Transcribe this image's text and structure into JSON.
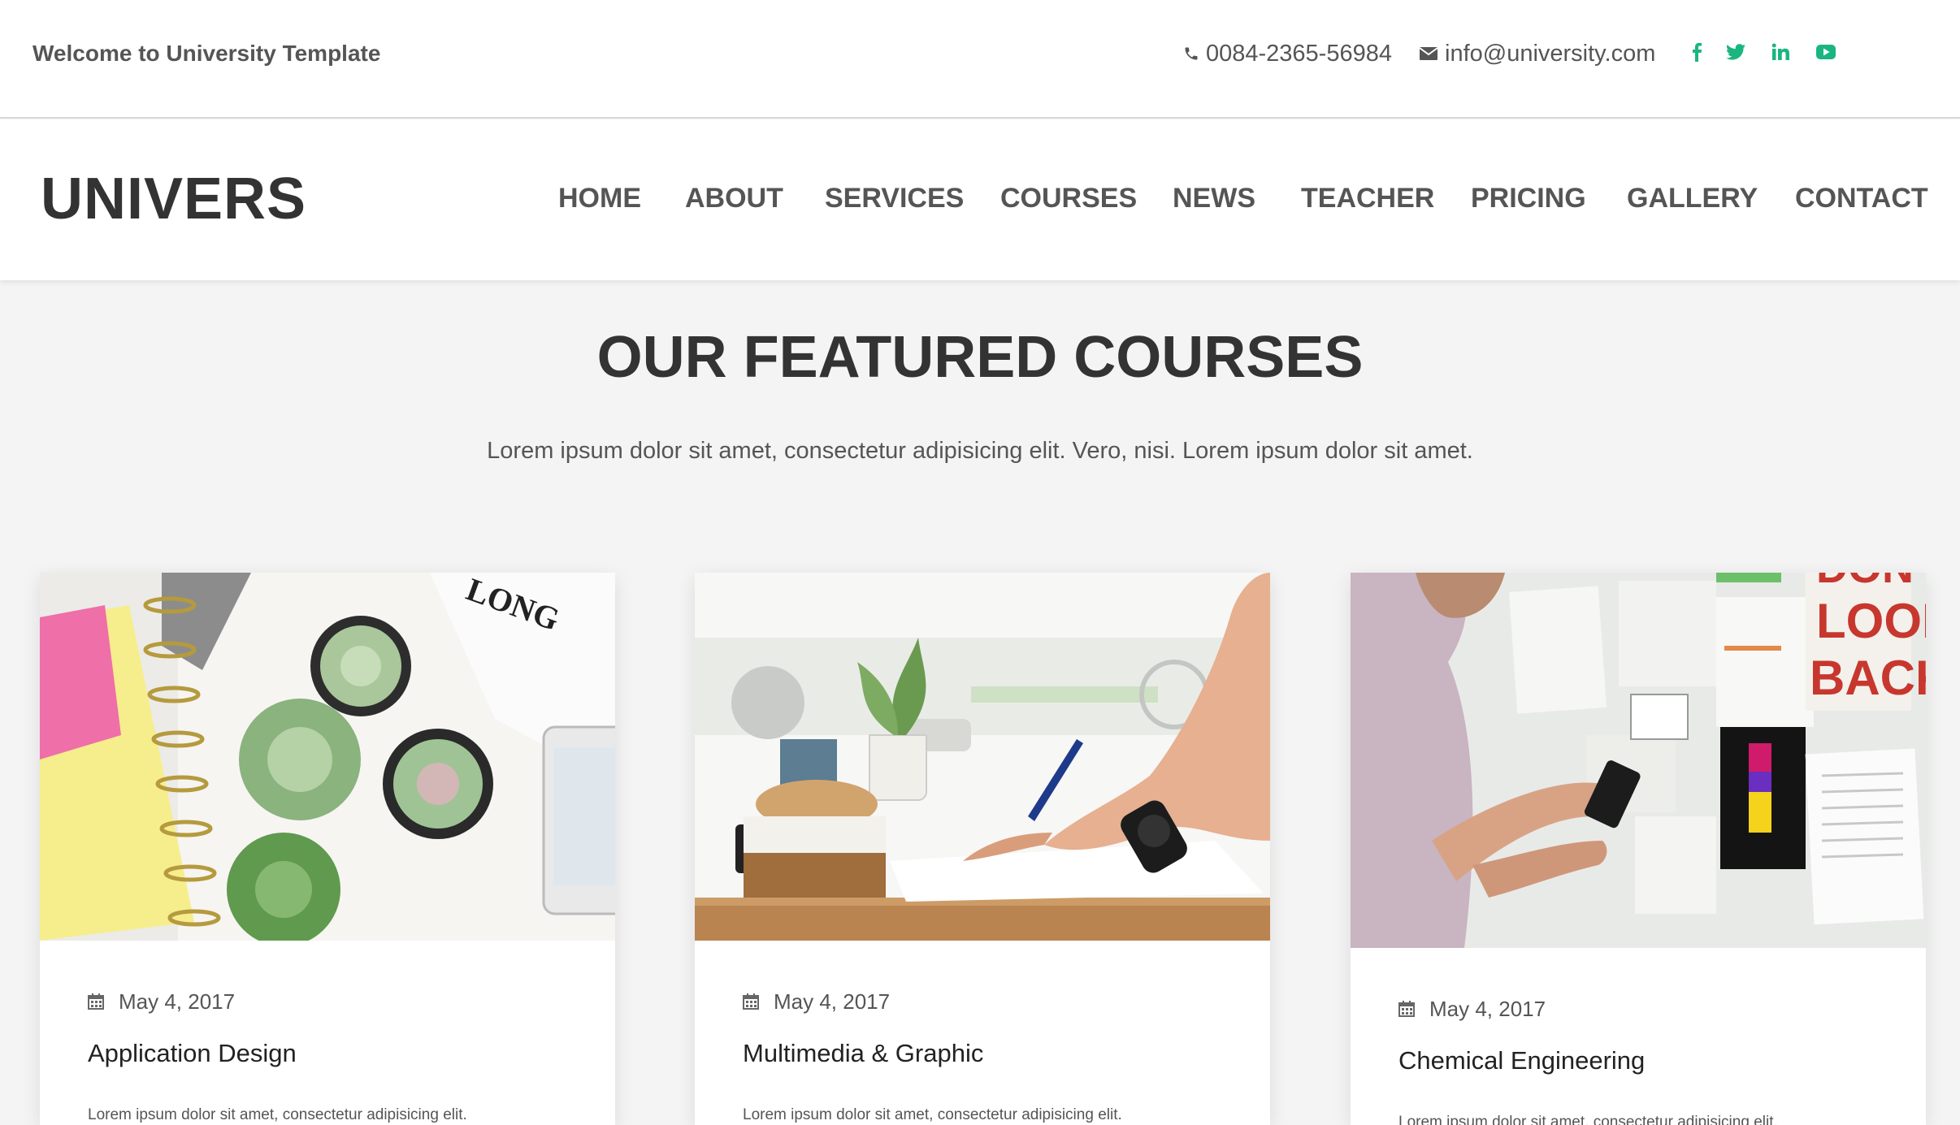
{
  "topbar": {
    "welcome": "Welcome to University Template",
    "phone": "0084-2365-56984",
    "email": "info@university.com",
    "social_color": "#1bb580",
    "social": [
      {
        "icon": "facebook-icon"
      },
      {
        "icon": "twitter-icon"
      },
      {
        "icon": "linkedin-icon"
      },
      {
        "icon": "youtube-icon"
      }
    ]
  },
  "header": {
    "logo": "UNIVERS",
    "nav": [
      "HOME",
      "ABOUT",
      "SERVICES",
      "COURSES",
      "NEWS",
      "TEACHER",
      "PRICING",
      "GALLERY",
      "CONTACT"
    ]
  },
  "section": {
    "title": "OUR FEATURED COURSES",
    "subtitle": "Lorem ipsum dolor sit amet, consectetur adipisicing elit. Vero, nisi. Lorem ipsum dolor sit amet."
  },
  "courses": [
    {
      "date": "May 4, 2017",
      "title": "Application Design",
      "excerpt": "Lorem ipsum dolor sit amet, consectetur adipisicing elit.",
      "image": "succulents-notebook-photo"
    },
    {
      "date": "May 4, 2017",
      "title": "Multimedia & Graphic",
      "excerpt": "Lorem ipsum dolor sit amet, consectetur adipisicing elit.",
      "image": "writing-desk-photo"
    },
    {
      "date": "May 4, 2017",
      "title": "Chemical Engineering",
      "excerpt": "Lorem ipsum dolor sit amet, consectetur adipisicing elit.",
      "image": "man-phone-wall-photo",
      "image_sign_text": [
        "DON'T",
        "LOOK",
        "BACK"
      ]
    }
  ]
}
